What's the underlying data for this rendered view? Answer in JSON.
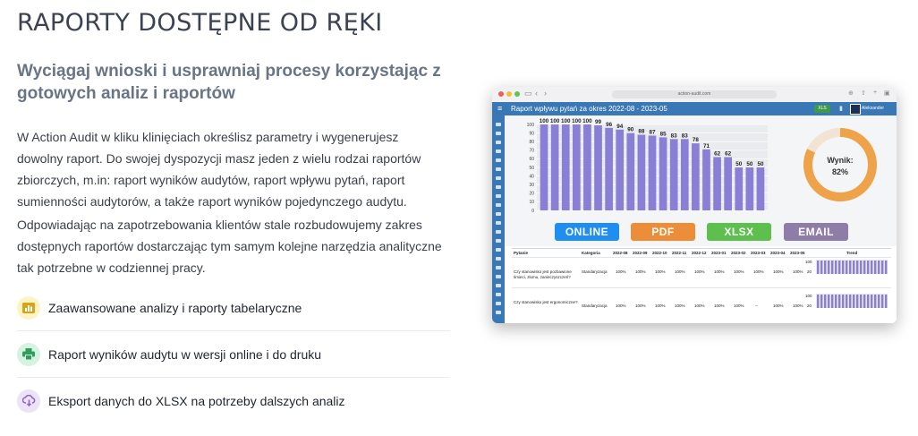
{
  "hero": {
    "title": "RAPORTY DOSTĘPNE OD RĘKI"
  },
  "subtitle": "Wyciągaj wnioski i usprawniaj procesy korzystając z gotowych analiz i raportów",
  "paragraphs": [
    "W Action Audit w kliku klinięciach określisz parametry i wygenerujesz dowolny raport. Do swojej dyspozycji masz jeden z wielu rodzai raportów zbiorczych, m.in: raport wyników audytów, raport wpływu pytań, raport sumienności audytorów, a także raport wyników pojedynczego audytu.",
    "Odpowiadając na zapotrzebowania klientów stale rozbudowujemy zakres dostępnych raportów dostarczając tym samym kolejne narzędzia analityczne tak potrzebne w codziennej pracy."
  ],
  "features": [
    {
      "label": "Zaawansowane analizy i raporty tabelaryczne",
      "icon": "bar-chart-icon",
      "bg": "#fdf3c4",
      "color": "#d6a51a"
    },
    {
      "label": "Raport wyników audytu w wersji online i do druku",
      "icon": "printer-icon",
      "bg": "#d6f2e1",
      "color": "#2f9e5b"
    },
    {
      "label": "Eksport danych do XLSX na potrzeby dalszych analiz",
      "icon": "cloud-download-icon",
      "bg": "#ece3f8",
      "color": "#8a63c9"
    }
  ],
  "screenshot": {
    "url": "action-audit.com",
    "report_title": "Raport wpływu pytań za okres 2022-08 - 2023-05",
    "xls_label": "XLS",
    "user": "Aleksander",
    "score_label": "Wynik:",
    "score_value": "82%",
    "score_fraction": 0.82,
    "buttons": [
      {
        "label": "ONLINE",
        "color": "#1f8ef1"
      },
      {
        "label": "PDF",
        "color": "#ec8e39"
      },
      {
        "label": "XLSX",
        "color": "#5cbf4e"
      },
      {
        "label": "EMAIL",
        "color": "#8e7ea7"
      }
    ],
    "colors": {
      "bar": "#8a7fd6",
      "header": "#3a78b5",
      "donut": "#eea24a"
    },
    "table": {
      "headers": [
        "Pytanie",
        "Kategoria",
        "2022-08",
        "2022-09",
        "2022-10",
        "2022-11",
        "2022-12",
        "2023-01",
        "2023-02",
        "2023-03",
        "2023-04",
        "2023-05",
        "Trend"
      ],
      "rows": [
        {
          "question": "Czy stanowisko jest pozbawione śmieci, złomu, zanieczyszczeń?",
          "category": "Standaryzacja",
          "values": [
            "100%",
            "100%",
            "100%",
            "100%",
            "100%",
            "100%",
            "100%",
            "100%",
            "100%",
            "100%"
          ],
          "trend_ticks": [
            "100",
            "20"
          ]
        },
        {
          "question": "Czy stanowisko jest ergonomiczne?",
          "category": "Standaryzacja",
          "values": [
            "100%",
            "100%",
            "100%",
            "100%",
            "100%",
            "100%",
            "100%",
            "--",
            "100%",
            "100%"
          ],
          "trend_ticks": [
            "100",
            "20"
          ]
        }
      ]
    }
  },
  "chart_data": {
    "type": "bar",
    "values": [
      100,
      100,
      100,
      100,
      100,
      99,
      96,
      94,
      90,
      88,
      87,
      85,
      83,
      83,
      78,
      71,
      62,
      62,
      50,
      50,
      50
    ],
    "y_ticks": [
      0,
      10,
      20,
      30,
      40,
      50,
      60,
      70,
      80,
      90,
      100
    ],
    "ylim": [
      0,
      100
    ],
    "grid": true,
    "bar_color": "#8a7fd6"
  }
}
